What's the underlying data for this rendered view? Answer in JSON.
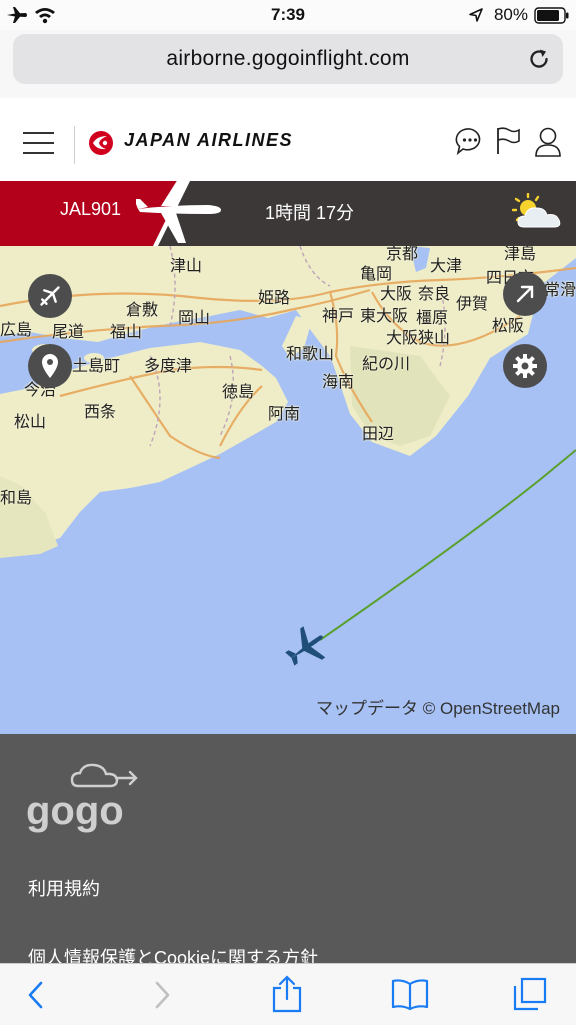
{
  "status_bar": {
    "time": "7:39",
    "battery_percent": "80%",
    "icons": [
      "airplane-mode-icon",
      "wifi-icon",
      "location-arrow-icon",
      "battery-icon"
    ]
  },
  "browser": {
    "url": "airborne.gogoinflight.com",
    "reload_icon": "reload-icon"
  },
  "header": {
    "brand": "JAPAN AIRLINES",
    "icons": [
      "menu-icon",
      "chat-icon",
      "flag-icon",
      "user-icon"
    ]
  },
  "flight": {
    "number": "JAL901",
    "time_remaining": "1時間 17分",
    "weather_icon": "partly-cloudy-icon"
  },
  "map": {
    "places": [
      "津山",
      "京都",
      "津島",
      "亀岡",
      "大津",
      "四日市",
      "常滑",
      "広島",
      "尾道",
      "福山",
      "倉敷",
      "岡山",
      "姫路",
      "神戸",
      "大阪",
      "奈良",
      "伊賀",
      "松阪",
      "東大阪",
      "橿原",
      "大阪狭山",
      "土島町",
      "多度津",
      "和歌山",
      "紀の川",
      "海南",
      "徳島",
      "阿南",
      "田辺",
      "今治",
      "松山",
      "西条",
      "和島"
    ],
    "attribution": "マップデータ © OpenStreetMap",
    "colors": {
      "sea": "#a7c1f4",
      "land": "#eeedc8",
      "route": "#5aa02c",
      "plane": "#1f4e79"
    }
  },
  "footer": {
    "logo": "gogo",
    "links": [
      "利用規約",
      "個人情報保護とCookieに関する方針"
    ]
  },
  "toolbar": {
    "icons": [
      "back-icon",
      "forward-icon",
      "share-icon",
      "bookmarks-icon",
      "tabs-icon"
    ]
  }
}
